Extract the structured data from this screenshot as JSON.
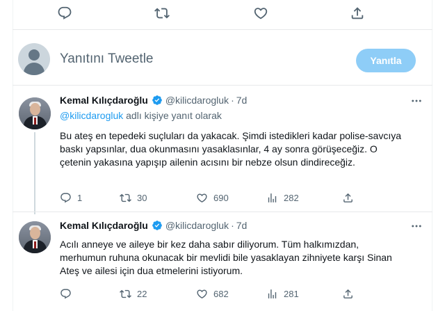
{
  "top_actions": {
    "reply_icon": "reply-icon",
    "retweet_icon": "retweet-icon",
    "like_icon": "like-icon",
    "share_icon": "share-icon"
  },
  "composer": {
    "placeholder": "Yanıtını Tweetle",
    "reply_button": "Yanıtla",
    "button_color": "#8ecdf7"
  },
  "tweets": [
    {
      "name": "Kemal Kılıçdaroğlu",
      "handle": "@kilicdarogluk",
      "dot": "·",
      "time": "7d",
      "replying_mention": "@kilicdarogluk",
      "replying_suffix": " adlı kişiye yanıt olarak",
      "text": "Bu ateş en tepedeki suçluları da yakacak. Şimdi istedikleri kadar polise-savcıya baskı yapsınlar, dua okunmasını yasaklasınlar, 4 ay sonra görüşeceğiz. O çetenin yakasına yapışıp ailenin acısını bir nebze olsun dindireceğiz.",
      "replies": "1",
      "retweets": "30",
      "likes": "690",
      "views": "282"
    },
    {
      "name": "Kemal Kılıçdaroğlu",
      "handle": "@kilicdarogluk",
      "dot": "·",
      "time": "7d",
      "text": "Acılı anneye ve aileye bir kez daha sabır diliyorum. Tüm halkımızdan, merhumun ruhuna okunacak bir mevlidi bile yasaklayan zihniyete karşı Sinan Ateş ve ailesi için dua etmelerini istiyorum.",
      "replies": "",
      "retweets": "22",
      "likes": "682",
      "views": "281"
    }
  ],
  "colors": {
    "verified": "#1d9bf0",
    "mention": "#1d9bf0",
    "muted": "#536471"
  }
}
